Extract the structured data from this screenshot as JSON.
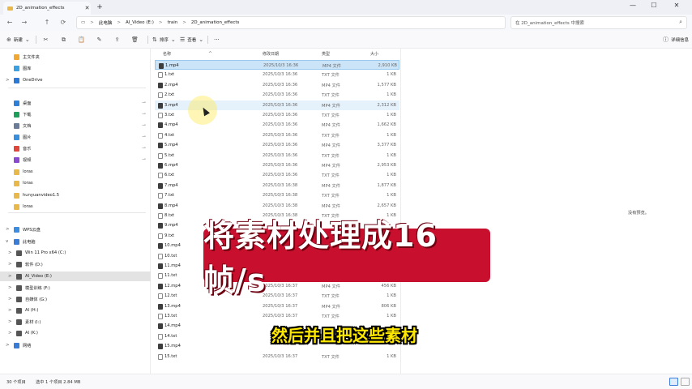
{
  "window": {
    "tab_title": "2D_animation_effects",
    "tab_close": "✕",
    "new_tab": "+",
    "minimize": "—",
    "maximize": "☐",
    "close": "✕"
  },
  "nav": {
    "back": "←",
    "forward": "→",
    "up": "↑",
    "refresh": "⟳",
    "pc_icon": "▭"
  },
  "address": {
    "crumbs": [
      "此电脑",
      "AI_Video (E:)",
      "train",
      "2D_animation_effects"
    ],
    "separator": ">"
  },
  "search": {
    "placeholder": "在 2D_animation_effects 中搜索",
    "icon": "⌕"
  },
  "toolbar": {
    "new_label": "新建",
    "sort_label": "排序",
    "view_label": "查看",
    "more": "···",
    "details_label": "详细信息",
    "icons": {
      "new": "⊕",
      "cut": "✂",
      "copy": "⧉",
      "paste": "📋",
      "rename": "✎",
      "share": "⇪",
      "delete": "🗑",
      "sort": "⇅",
      "view": "☰",
      "details": "ⓘ"
    }
  },
  "sidebar": {
    "items": [
      {
        "label": "主文件夹",
        "icon": "home-icon",
        "color": "#f0a830",
        "chev": ""
      },
      {
        "label": "图库",
        "icon": "gallery-icon",
        "color": "#3aa0e0",
        "chev": ""
      },
      {
        "label": "OneDrive",
        "icon": "cloud-icon",
        "color": "#2b78d6",
        "chev": ">"
      },
      {
        "label": "桌面",
        "icon": "desktop-icon",
        "color": "#2f7fd8",
        "chev": "",
        "pinned": true
      },
      {
        "label": "下载",
        "icon": "download-icon",
        "color": "#1e9e5a",
        "chev": "",
        "pinned": true
      },
      {
        "label": "文档",
        "icon": "document-icon",
        "color": "#6b7c99",
        "chev": "",
        "pinned": true
      },
      {
        "label": "图片",
        "icon": "pictures-icon",
        "color": "#3a8fdc",
        "chev": "",
        "pinned": true
      },
      {
        "label": "音乐",
        "icon": "music-icon",
        "color": "#e0463a",
        "chev": "",
        "pinned": true
      },
      {
        "label": "视频",
        "icon": "video-icon",
        "color": "#8a4ad0",
        "chev": "",
        "pinned": true
      },
      {
        "label": "loras",
        "icon": "folder-icon",
        "color": "#e8b84a",
        "chev": ""
      },
      {
        "label": "loras",
        "icon": "folder-icon",
        "color": "#e8b84a",
        "chev": ""
      },
      {
        "label": "hunyuanvideo1.5",
        "icon": "folder-icon",
        "color": "#e8b84a",
        "chev": ""
      },
      {
        "label": "loras",
        "icon": "folder-icon",
        "color": "#e8b84a",
        "chev": ""
      },
      {
        "label": "WPS云盘",
        "icon": "cloud-icon",
        "color": "#3c8ce0",
        "chev": ">"
      },
      {
        "label": "此电脑",
        "icon": "pc-icon",
        "color": "#3a7bd5",
        "chev": "v"
      },
      {
        "label": "Win 11 Pro x64 (C:)",
        "icon": "drive-icon",
        "color": "#555555",
        "chev": ">"
      },
      {
        "label": "软件 (D:)",
        "icon": "drive-icon",
        "color": "#555555",
        "chev": ">"
      },
      {
        "label": "AI_Video (E:)",
        "icon": "drive-icon",
        "color": "#555555",
        "chev": ">"
      },
      {
        "label": "模型训练 (F:)",
        "icon": "drive-icon",
        "color": "#555555",
        "chev": ">"
      },
      {
        "label": "自媒体 (G:)",
        "icon": "drive-icon",
        "color": "#555555",
        "chev": ">"
      },
      {
        "label": "AI (H:)",
        "icon": "drive-icon",
        "color": "#555555",
        "chev": ">"
      },
      {
        "label": "素材 (I:)",
        "icon": "drive-icon",
        "color": "#555555",
        "chev": ">"
      },
      {
        "label": "AI (K:)",
        "icon": "drive-icon",
        "color": "#555555",
        "chev": ">"
      },
      {
        "label": "网络",
        "icon": "network-icon",
        "color": "#3a7bd5",
        "chev": ">"
      }
    ],
    "pin_glyph": "📌"
  },
  "columns": {
    "name": "名称",
    "date": "修改日期",
    "type": "类型",
    "size": "大小",
    "sort_glyph": "^"
  },
  "files": [
    {
      "name": "1.mp4",
      "date": "2025/10/3 16:36",
      "type": "MP4 文件",
      "size": "2,910 KB",
      "kind": "mp4"
    },
    {
      "name": "1.txt",
      "date": "2025/10/3 16:36",
      "type": "TXT 文件",
      "size": "1 KB",
      "kind": "txt"
    },
    {
      "name": "2.mp4",
      "date": "2025/10/3 16:36",
      "type": "MP4 文件",
      "size": "1,577 KB",
      "kind": "mp4"
    },
    {
      "name": "2.txt",
      "date": "2025/10/3 16:36",
      "type": "TXT 文件",
      "size": "1 KB",
      "kind": "txt"
    },
    {
      "name": "3.mp4",
      "date": "2025/10/3 16:36",
      "type": "MP4 文件",
      "size": "2,312 KB",
      "kind": "mp4"
    },
    {
      "name": "3.txt",
      "date": "2025/10/3 16:36",
      "type": "TXT 文件",
      "size": "1 KB",
      "kind": "txt"
    },
    {
      "name": "4.mp4",
      "date": "2025/10/3 16:36",
      "type": "MP4 文件",
      "size": "1,662 KB",
      "kind": "mp4"
    },
    {
      "name": "4.txt",
      "date": "2025/10/3 16:36",
      "type": "TXT 文件",
      "size": "1 KB",
      "kind": "txt"
    },
    {
      "name": "5.mp4",
      "date": "2025/10/3 16:36",
      "type": "MP4 文件",
      "size": "3,377 KB",
      "kind": "mp4"
    },
    {
      "name": "5.txt",
      "date": "2025/10/3 16:36",
      "type": "TXT 文件",
      "size": "1 KB",
      "kind": "txt"
    },
    {
      "name": "6.mp4",
      "date": "2025/10/3 16:36",
      "type": "MP4 文件",
      "size": "2,953 KB",
      "kind": "mp4"
    },
    {
      "name": "6.txt",
      "date": "2025/10/3 16:36",
      "type": "TXT 文件",
      "size": "1 KB",
      "kind": "txt"
    },
    {
      "name": "7.mp4",
      "date": "2025/10/3 16:38",
      "type": "MP4 文件",
      "size": "1,877 KB",
      "kind": "mp4"
    },
    {
      "name": "7.txt",
      "date": "2025/10/3 16:38",
      "type": "TXT 文件",
      "size": "1 KB",
      "kind": "txt"
    },
    {
      "name": "8.mp4",
      "date": "2025/10/3 16:38",
      "type": "MP4 文件",
      "size": "2,657 KB",
      "kind": "mp4"
    },
    {
      "name": "8.txt",
      "date": "2025/10/3 16:38",
      "type": "TXT 文件",
      "size": "1 KB",
      "kind": "txt"
    },
    {
      "name": "9.mp4",
      "date": "",
      "type": "",
      "size": "",
      "kind": "mp4"
    },
    {
      "name": "9.txt",
      "date": "",
      "type": "",
      "size": "",
      "kind": "txt"
    },
    {
      "name": "10.mp4",
      "date": "",
      "type": "",
      "size": "",
      "kind": "mp4"
    },
    {
      "name": "10.txt",
      "date": "",
      "type": "",
      "size": "",
      "kind": "txt"
    },
    {
      "name": "11.mp4",
      "date": "",
      "type": "",
      "size": "",
      "kind": "mp4"
    },
    {
      "name": "11.txt",
      "date": "",
      "type": "",
      "size": "",
      "kind": "txt"
    },
    {
      "name": "12.mp4",
      "date": "2025/10/3 16:37",
      "type": "MP4 文件",
      "size": "456 KB",
      "kind": "mp4"
    },
    {
      "name": "12.txt",
      "date": "2025/10/3 16:37",
      "type": "TXT 文件",
      "size": "1 KB",
      "kind": "txt"
    },
    {
      "name": "13.mp4",
      "date": "2025/10/3 16:37",
      "type": "MP4 文件",
      "size": "806 KB",
      "kind": "mp4"
    },
    {
      "name": "13.txt",
      "date": "2025/10/3 16:37",
      "type": "TXT 文件",
      "size": "1 KB",
      "kind": "txt"
    },
    {
      "name": "14.mp4",
      "date": "",
      "type": "",
      "size": "",
      "kind": "mp4"
    },
    {
      "name": "14.txt",
      "date": "",
      "type": "",
      "size": "",
      "kind": "txt"
    },
    {
      "name": "15.mp4",
      "date": "",
      "type": "",
      "size": "",
      "kind": "mp4"
    },
    {
      "name": "15.txt",
      "date": "2025/10/3 16:37",
      "type": "TXT 文件",
      "size": "1 KB",
      "kind": "txt"
    }
  ],
  "preview": {
    "message": "没有预览。"
  },
  "status": {
    "count": "30 个项目",
    "selection": "选中 1 个项目  2.84 MB",
    "details_view_icon": "☰",
    "tiles_view_icon": "▦"
  },
  "overlay": {
    "banner": "将素材处理成16帧/s",
    "banner_color": "#c8102e",
    "subtitle": "然后并且把这些素材",
    "subtitle_color": "#ffe800"
  }
}
